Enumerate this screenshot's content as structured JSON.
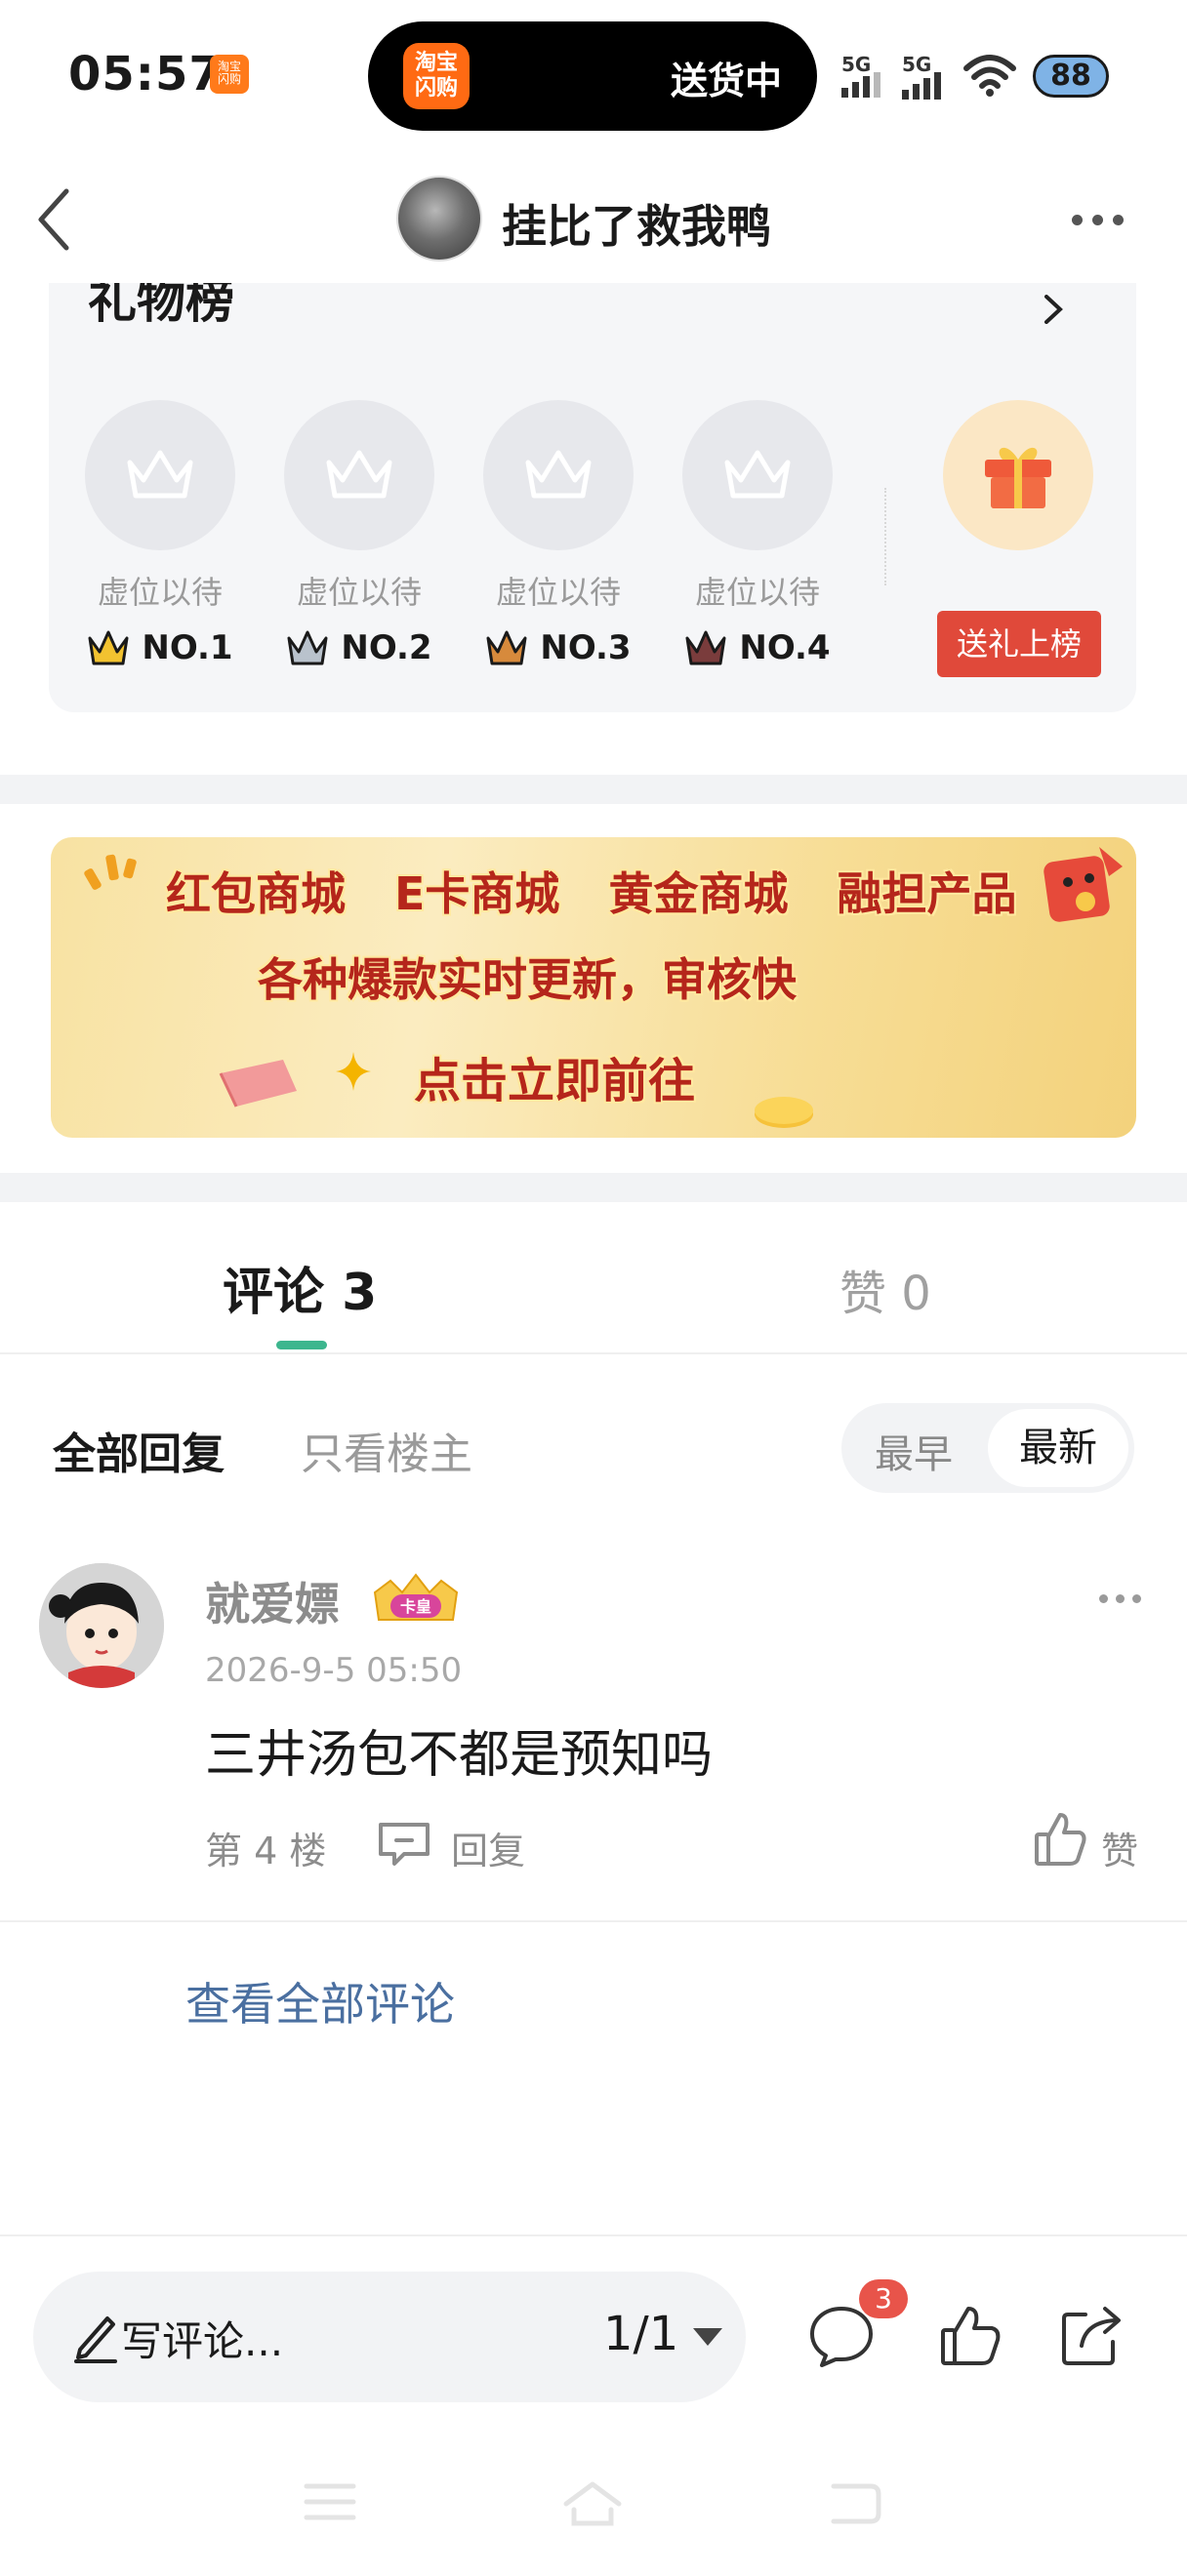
{
  "status_bar": {
    "time": "05:57",
    "island_text": "送货中",
    "island_app": "淘宝闪购",
    "signal1": "5G",
    "signal2": "5G",
    "battery": "88"
  },
  "nav": {
    "title": "挂比了救我鸭"
  },
  "gift_rank": {
    "title": "礼物榜",
    "slots": [
      {
        "label": "虚位以待",
        "rank": "NO.1",
        "crown_color": "#f2c230"
      },
      {
        "label": "虚位以待",
        "rank": "NO.2",
        "crown_color": "#b9c2cc"
      },
      {
        "label": "虚位以待",
        "rank": "NO.3",
        "crown_color": "#d78a3c"
      },
      {
        "label": "虚位以待",
        "rank": "NO.4",
        "crown_color": "#7a3c3c"
      }
    ],
    "send_button": "送礼上榜"
  },
  "banner": {
    "row1": [
      "红包商城",
      "E卡商城",
      "黄金商城",
      "融担产品"
    ],
    "row2": "各种爆款实时更新，审核快",
    "cta": "点击立即前往"
  },
  "tabs": {
    "comments": "评论 3",
    "likes": "赞 0"
  },
  "filter": {
    "all": "全部回复",
    "owner_only": "只看楼主",
    "sort_earliest": "最早",
    "sort_latest": "最新"
  },
  "comments": [
    {
      "user": "就爱嫖",
      "badge": "卡皇",
      "time": "2026-9-5 05:50",
      "text": "三井汤包不都是预知吗",
      "floor": "第 4 楼",
      "reply_label": "回复",
      "like_label": "赞"
    }
  ],
  "view_all": "查看全部评论",
  "bottom_bar": {
    "placeholder": "写评论...",
    "page": "1/1",
    "comment_count": "3"
  },
  "colors": {
    "accent_green": "#3db68e",
    "send_red": "#e0493a",
    "link_blue": "#4a6fa0"
  }
}
